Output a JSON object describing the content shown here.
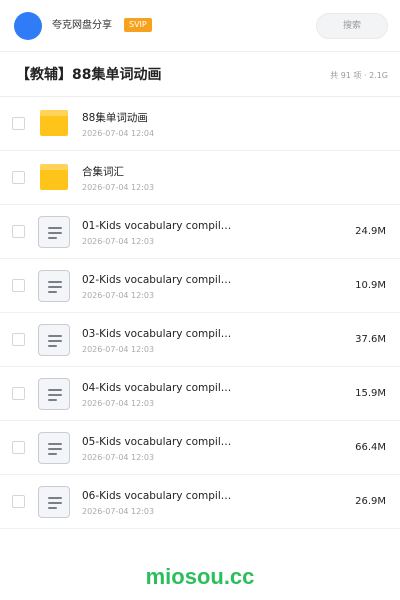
{
  "header": {
    "share_name": "夸克网盘分享",
    "svip_label": "SVIP",
    "search_placeholder": "搜索"
  },
  "folder": {
    "title": "【教辅】88集单词动画",
    "meta": "共 91 项 · 2.1G"
  },
  "files": [
    {
      "type": "folder",
      "name": "88集单词动画",
      "date": "2026-07-04 12:04",
      "size": ""
    },
    {
      "type": "folder",
      "name": "合集词汇",
      "date": "2026-07-04 12:03",
      "size": ""
    },
    {
      "type": "file",
      "name": "01-Kids vocabulary compil…",
      "date": "2026-07-04 12:03",
      "size": "24.9M"
    },
    {
      "type": "file",
      "name": "02-Kids vocabulary compil…",
      "date": "2026-07-04 12:03",
      "size": "10.9M"
    },
    {
      "type": "file",
      "name": "03-Kids vocabulary compil…",
      "date": "2026-07-04 12:03",
      "size": "37.6M"
    },
    {
      "type": "file",
      "name": "04-Kids vocabulary compil…",
      "date": "2026-07-04 12:03",
      "size": "15.9M"
    },
    {
      "type": "file",
      "name": "05-Kids vocabulary compil…",
      "date": "2026-07-04 12:03",
      "size": "66.4M"
    },
    {
      "type": "file",
      "name": "06-Kids vocabulary compil…",
      "date": "2026-07-04 12:03",
      "size": "26.9M"
    }
  ],
  "icons": {
    "folder": "folder-icon",
    "file": "document-icon"
  },
  "colors": {
    "avatar": "#2f7cf6",
    "svip": "#f7a21e",
    "folder": "#ffc41a",
    "watermark": "#2bbf5c"
  },
  "watermark": "miosou.cc"
}
